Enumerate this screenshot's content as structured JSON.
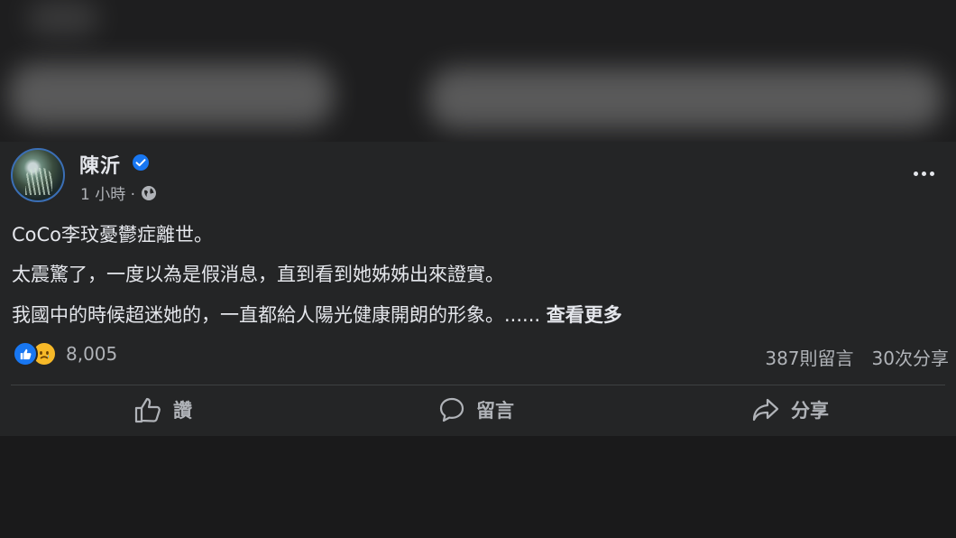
{
  "post": {
    "author": "陳沂",
    "timestamp": "1 小時 ·",
    "verified_icon": "verified-badge-icon",
    "privacy_icon": "globe-icon",
    "lines": [
      "CoCo李玟憂鬱症離世。",
      "太震驚了，一度以為是假消息，直到看到她姊姊出來證實。",
      "我國中的時候超迷她的，一直都給人陽光健康開朗的形象。......"
    ],
    "see_more": "查看更多",
    "reaction_count": "8,005",
    "comments": "387則留言",
    "shares": "30次分享"
  },
  "actions": {
    "like": "讚",
    "comment": "留言",
    "share": "分享"
  },
  "colors": {
    "background": "#242526",
    "text": "#e4e6eb",
    "secondary": "#b0b3b8",
    "accent": "#1877f2"
  }
}
